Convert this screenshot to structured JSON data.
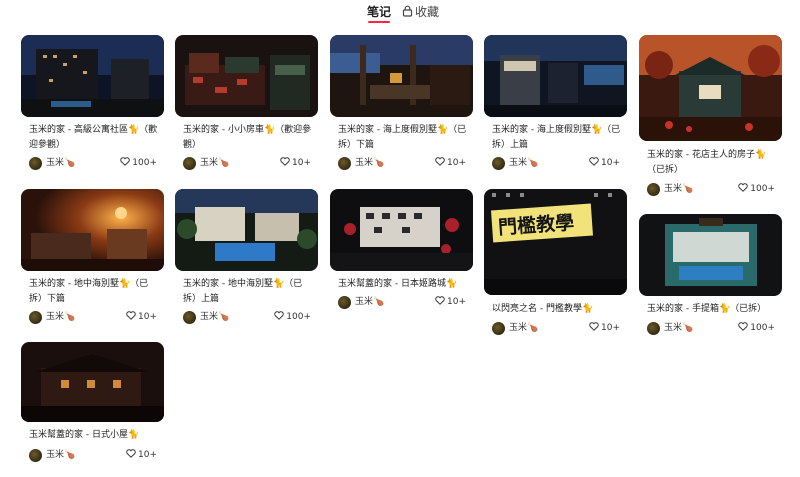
{
  "tabs": [
    {
      "label": "笔记",
      "active": true
    },
    {
      "label": "收藏",
      "active": false,
      "icon": "lock-icon"
    }
  ],
  "colors": {
    "accent": "#ff2442"
  },
  "notes": [
    {
      "title": "玉米的家 - 高級公寓社區🐈（歡迎參觀）",
      "author": "玉米🍗",
      "likes": "100+"
    },
    {
      "title": "玉米的家 - 小小房車🐈（歡迎參觀）",
      "author": "玉米🍗",
      "likes": "10+"
    },
    {
      "title": "玉米的家 - 海上度假別墅🐈（已拆）下篇",
      "author": "玉米🍗",
      "likes": "10+"
    },
    {
      "title": "玉米的家 - 海上度假別墅🐈（已拆）上篇",
      "author": "玉米🍗",
      "likes": "10+"
    },
    {
      "title": "玉米的家 - 花店主人的房子🐈（已拆）",
      "author": "玉米🍗",
      "likes": "100+"
    },
    {
      "title": "玉米的家 - 地中海別墅🐈（已拆）下篇",
      "author": "玉米🍗",
      "likes": "10+"
    },
    {
      "title": "玉米的家 - 地中海別墅🐈（已拆）上篇",
      "author": "玉米🍗",
      "likes": "100+"
    },
    {
      "title": "玉米幫蓋的家 - 日本姬路城🐈",
      "author": "玉米🍗",
      "likes": "10+"
    },
    {
      "title": "以閃亮之名 - 門檻教學🐈",
      "author": "玉米🍗",
      "likes": "10+",
      "image_text": "門檻教學"
    },
    {
      "title": "玉米的家 - 手提箱🐈（已拆）",
      "author": "玉米🍗",
      "likes": "100+"
    },
    {
      "title": "玉米幫蓋的家 - 日式小屋🐈",
      "author": "玉米🍗",
      "likes": "10+"
    }
  ]
}
